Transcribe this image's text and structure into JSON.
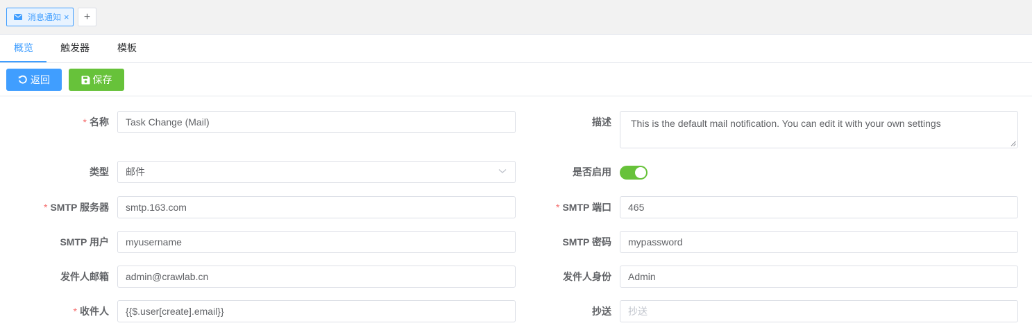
{
  "tabs": {
    "file_tab_label": "消息通知",
    "close_glyph": "×",
    "add_glyph": "+"
  },
  "subnav": {
    "items": [
      "概览",
      "触发器",
      "模板"
    ],
    "active": 0
  },
  "toolbar": {
    "back_label": "返回",
    "save_label": "保存"
  },
  "form": {
    "name": {
      "label": "名称",
      "required": true,
      "value": "Task Change (Mail)"
    },
    "description": {
      "label": "描述",
      "value": "This is the default mail notification. You can edit it with your own settings"
    },
    "type": {
      "label": "类型",
      "value": "邮件"
    },
    "enabled": {
      "label": "是否启用",
      "value": true
    },
    "smtp_server": {
      "label": "SMTP 服务器",
      "required": true,
      "value": "smtp.163.com"
    },
    "smtp_port": {
      "label": "SMTP 端口",
      "required": true,
      "value": "465"
    },
    "smtp_user": {
      "label": "SMTP 用户",
      "value": "myusername"
    },
    "smtp_password": {
      "label": "SMTP 密码",
      "value": "mypassword"
    },
    "sender_email": {
      "label": "发件人邮箱",
      "value": "admin@crawlab.cn"
    },
    "sender_identity": {
      "label": "发件人身份",
      "value": "Admin"
    },
    "recipients": {
      "label": "收件人",
      "required": true,
      "value": "{{$.user[create].email}}"
    },
    "cc": {
      "label": "抄送",
      "placeholder": "抄送"
    }
  },
  "colors": {
    "primary": "#409eff",
    "success": "#67c23a",
    "danger": "#f56c6c"
  },
  "icons": {
    "tab": "mail-icon",
    "back": "undo-icon",
    "save": "floppy-disk-icon",
    "select": "chevron-down-icon"
  }
}
